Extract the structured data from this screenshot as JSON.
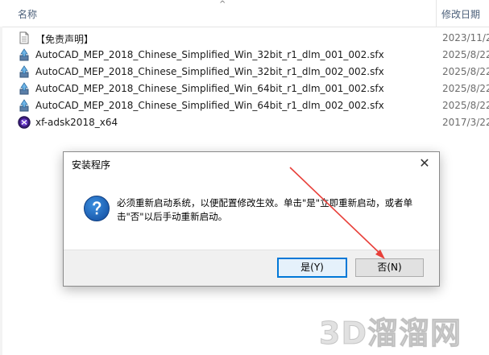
{
  "header": {
    "name_label": "名称",
    "date_label": "修改日期",
    "sort_indicator": "^"
  },
  "files": [
    {
      "name": "【免责声明】",
      "date": "2023/11/2",
      "icon": "document-icon"
    },
    {
      "name": "AutoCAD_MEP_2018_Chinese_Simplified_Win_32bit_r1_dlm_001_002.sfx",
      "date": "2025/8/22",
      "icon": "installer-icon"
    },
    {
      "name": "AutoCAD_MEP_2018_Chinese_Simplified_Win_32bit_r1_dlm_002_002.sfx",
      "date": "2025/8/22",
      "icon": "installer-icon"
    },
    {
      "name": "AutoCAD_MEP_2018_Chinese_Simplified_Win_64bit_r1_dlm_001_002.sfx",
      "date": "2025/8/22",
      "icon": "installer-icon"
    },
    {
      "name": "AutoCAD_MEP_2018_Chinese_Simplified_Win_64bit_r1_dlm_002_002.sfx",
      "date": "2025/8/22",
      "icon": "installer-icon"
    },
    {
      "name": "xf-adsk2018_x64",
      "date": "2017/3/22",
      "icon": "keygen-icon"
    }
  ],
  "dialog": {
    "title": "安装程序",
    "close_label": "✕",
    "message": "必须重新启动系统，以便配置修改生效。单击\"是\"立即重新启动，或者单击\"否\"以后手动重新启动。",
    "yes_label": "是(Y)",
    "no_label": "否(N)"
  },
  "annotation": {
    "arrow_color": "#e8403a"
  },
  "watermark": "3D溜溜网"
}
